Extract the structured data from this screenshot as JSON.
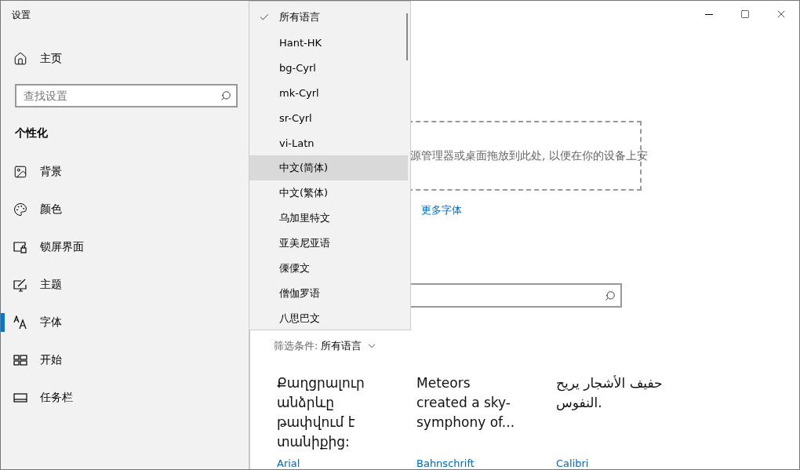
{
  "window": {
    "title": "设置"
  },
  "sidebar": {
    "home": "主页",
    "search": {
      "placeholder": "查找设置"
    },
    "section": "个性化",
    "items": [
      {
        "label": "背景",
        "kind": "background",
        "selected": false
      },
      {
        "label": "颜色",
        "kind": "colors",
        "selected": false
      },
      {
        "label": "锁屏界面",
        "kind": "lockscreen",
        "selected": false
      },
      {
        "label": "主题",
        "kind": "themes",
        "selected": false
      },
      {
        "label": "字体",
        "kind": "fonts",
        "selected": true
      },
      {
        "label": "开始",
        "kind": "start",
        "selected": false
      },
      {
        "label": "任务栏",
        "kind": "taskbar",
        "selected": false
      }
    ]
  },
  "main": {
    "drop_zone": {
      "text": "源管理器或桌面拖放到此处, 以便在你的设备上安"
    },
    "link": "更多字体",
    "filter": {
      "label": "筛选条件:",
      "value": "所有语言"
    },
    "fonts": [
      {
        "preview": "Քաղցրալուր անձրևը թափվում է տանիքից:",
        "name": "Arial"
      },
      {
        "preview": "Meteors created a sky-symphony of...",
        "name": "Bahnschrift"
      },
      {
        "preview": "حفيف الأشجار يريح النفوس.",
        "name": "Calibri"
      }
    ]
  },
  "dropdown": {
    "options": [
      {
        "label": "所有语言",
        "selected": true,
        "highlighted": false
      },
      {
        "label": "Hant-HK",
        "selected": false,
        "highlighted": false
      },
      {
        "label": "bg-Cyrl",
        "selected": false,
        "highlighted": false
      },
      {
        "label": "mk-Cyrl",
        "selected": false,
        "highlighted": false
      },
      {
        "label": "sr-Cyrl",
        "selected": false,
        "highlighted": false
      },
      {
        "label": "vi-Latn",
        "selected": false,
        "highlighted": false
      },
      {
        "label": "中文(简体)",
        "selected": false,
        "highlighted": true
      },
      {
        "label": "中文(繁体)",
        "selected": false,
        "highlighted": false
      },
      {
        "label": "乌加里特文",
        "selected": false,
        "highlighted": false
      },
      {
        "label": "亚美尼亚语",
        "selected": false,
        "highlighted": false
      },
      {
        "label": "傈僳文",
        "selected": false,
        "highlighted": false
      },
      {
        "label": "僧伽罗语",
        "selected": false,
        "highlighted": false
      },
      {
        "label": "八思巴文",
        "selected": false,
        "highlighted": false
      }
    ]
  }
}
